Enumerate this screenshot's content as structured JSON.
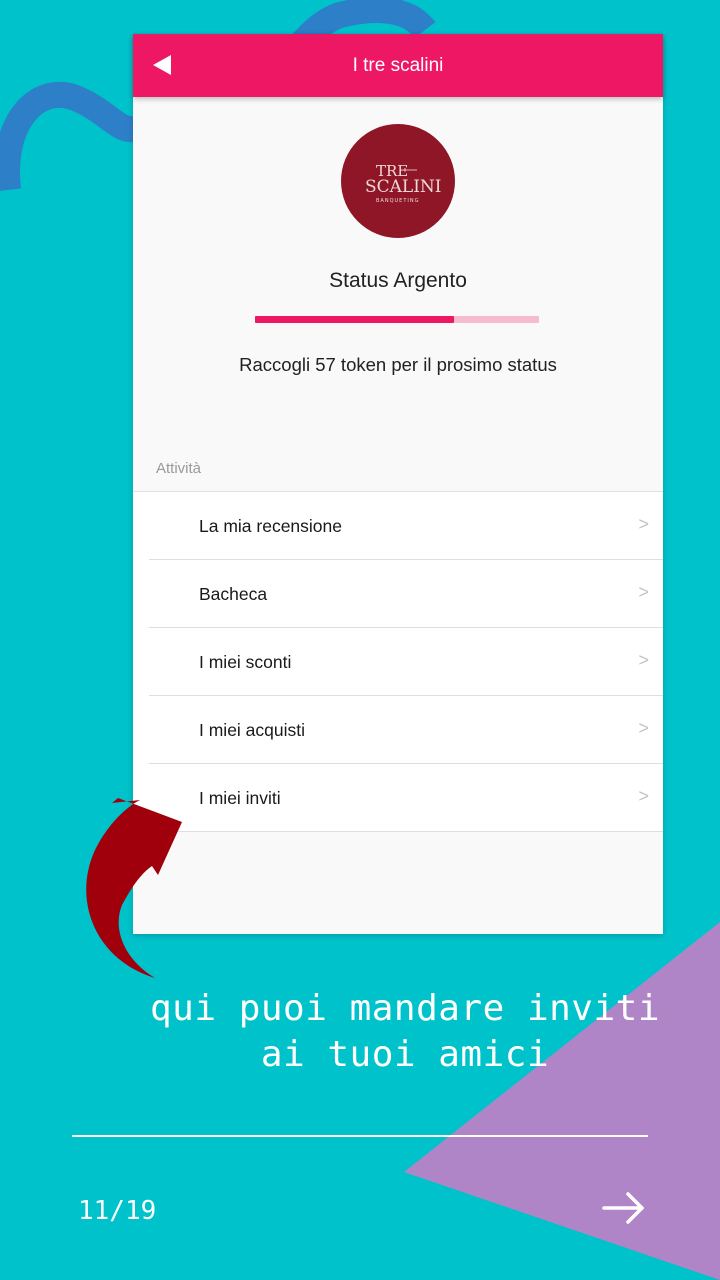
{
  "colors": {
    "background": "#00c2cb",
    "app_bar": "#ed1763",
    "accent_pink": "#ed1763",
    "progress_track": "#f4bccc",
    "logo_circle": "#8f1626",
    "arrow_red": "#a0000c",
    "deco_blue": "#2d7fc7",
    "deco_purple": "#b085c7"
  },
  "app": {
    "title": "I tre scalini",
    "back_icon": "back-arrow-icon"
  },
  "logo": {
    "line1": "TRE",
    "line2": "SCALINI",
    "tagline": "BANQUETING"
  },
  "status": {
    "title": "Status Argento",
    "progress": 0.7,
    "token_text": "Raccogli 57 token per il prosimo status"
  },
  "activities": {
    "section_label": "Attività",
    "items": [
      {
        "label": "La mia recensione",
        "chevron": ">"
      },
      {
        "label": "Bacheca",
        "chevron": ">"
      },
      {
        "label": "I miei sconti",
        "chevron": ">"
      },
      {
        "label": "I miei acquisti",
        "chevron": ">"
      },
      {
        "label": "I miei inviti",
        "chevron": ">"
      }
    ]
  },
  "slide": {
    "caption_line1": "qui puoi mandare inviti",
    "caption_line2": "ai tuoi amici",
    "page_counter": "11/19",
    "next_icon": "arrow-right-icon"
  }
}
